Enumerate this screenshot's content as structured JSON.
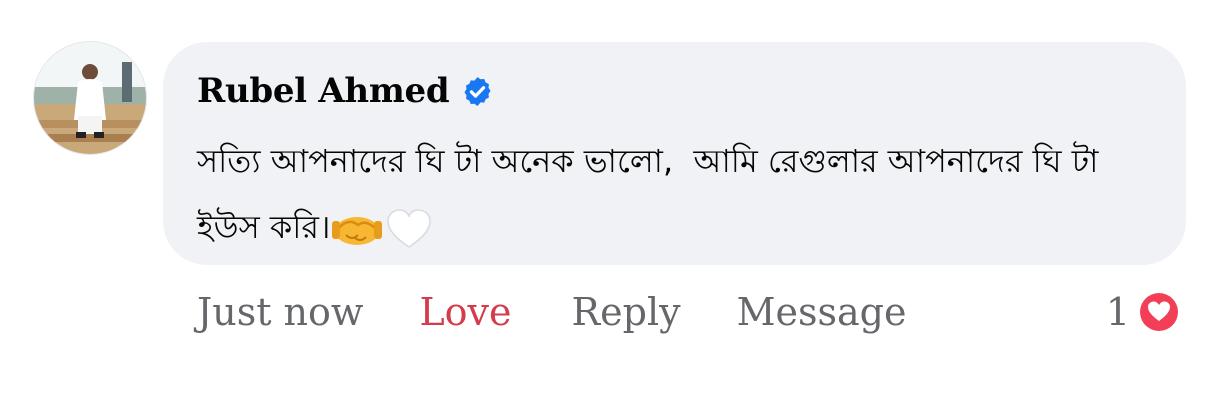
{
  "comment": {
    "author": "Rubel Ahmed",
    "verified_icon": "verified-badge-icon",
    "text": "সত্যি আপনাদের ঘি টা অনেক ভালো,  আমি রেগুলার আপনাদের ঘি টা ইউস করি।",
    "trailing_emojis": [
      "handshake-emoji",
      "white-heart-emoji"
    ]
  },
  "actions": {
    "time": "Just now",
    "love": "Love",
    "reply": "Reply",
    "message": "Message"
  },
  "reactions": {
    "count": "1",
    "icon": "love-reaction-icon"
  },
  "colors": {
    "bubble_bg": "#f0f2f5",
    "verified_blue": "#1877f2",
    "love_red": "#d43b4c",
    "muted_text": "#65676b"
  }
}
